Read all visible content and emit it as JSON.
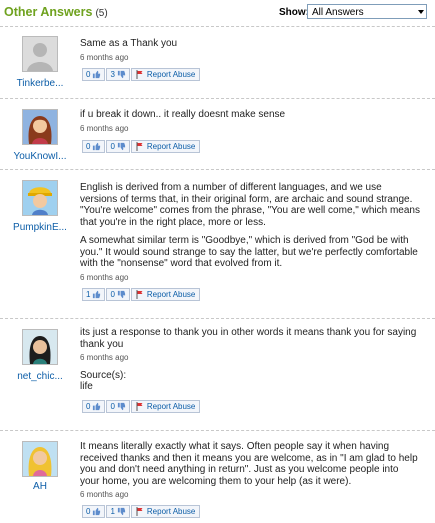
{
  "header": {
    "title": "Other Answers",
    "count": "(5)",
    "show_label": "Show:",
    "show_value": "All Answers"
  },
  "answers": [
    {
      "username": "Tinkerbe...",
      "paragraphs": [
        "Same as a Thank you"
      ],
      "time": "6 months ago",
      "up": "0",
      "down": "3",
      "report": "Report Abuse"
    },
    {
      "username": "YouKnowI...",
      "paragraphs": [
        "if u break it down.. it really doesnt make sense"
      ],
      "time": "6 months ago",
      "up": "0",
      "down": "0",
      "report": "Report Abuse"
    },
    {
      "username": "PumpkinE...",
      "paragraphs": [
        "English is derived from a number of different languages, and we use versions of terms that, in their original form, are archaic and sound strange. \"You're welcome\" comes from the phrase, \"You are well come,\" which means that you're in the right place, more or less.",
        "A somewhat similar term is \"Goodbye,\" which is derived from \"God be with you.\" It would sound strange to say the latter, but we're perfectly comfortable with the \"nonsense\" word that evolved from it."
      ],
      "time": "6 months ago",
      "up": "1",
      "down": "0",
      "report": "Report Abuse"
    },
    {
      "username": "net_chic...",
      "paragraphs": [
        "its just a response to thank you in other words it means thank you for saying thank you"
      ],
      "time": "6 months ago",
      "source_label": "Source(s):",
      "source_value": "life",
      "up": "0",
      "down": "0",
      "report": "Report Abuse"
    },
    {
      "username": "AH",
      "paragraphs": [
        "It means literally exactly what it says. Often people say it when having received thanks and then it means you are welcome, as in \"I am glad to help you and don't need anything in return\". Just as you welcome people into your home, you are welcoming them to your help (as it were)."
      ],
      "time": "6 months ago",
      "up": "0",
      "down": "1",
      "report": "Report Abuse"
    }
  ]
}
